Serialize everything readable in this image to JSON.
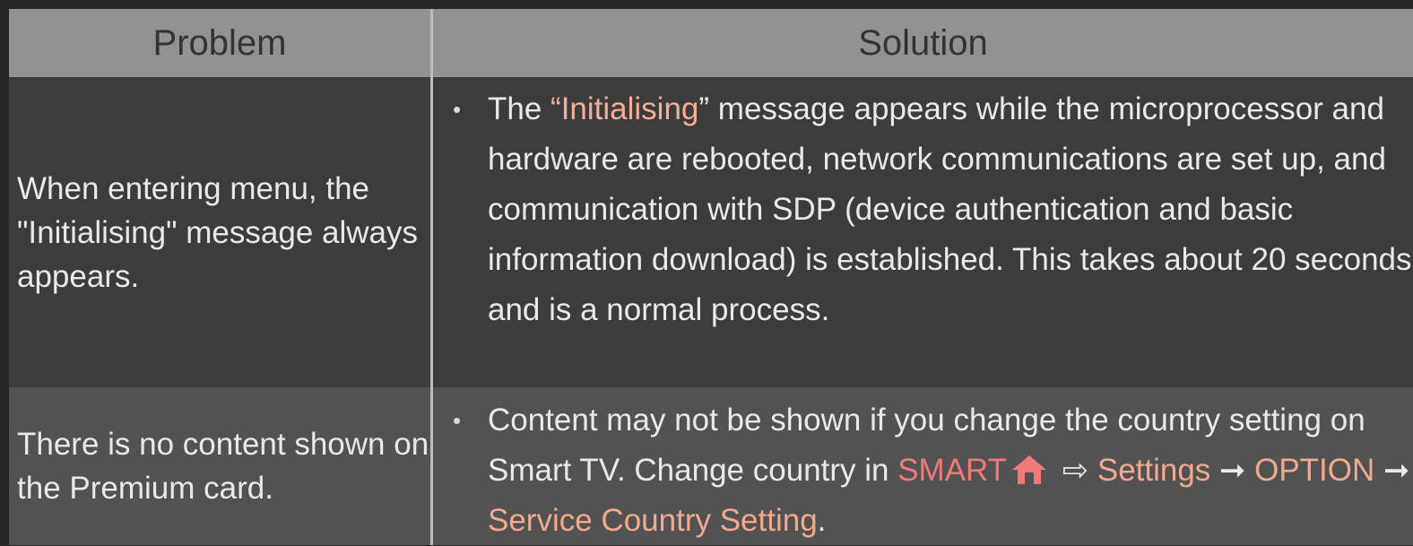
{
  "header": {
    "problem": "Problem",
    "solution": "Solution"
  },
  "rows": [
    {
      "problem": "When entering menu, the \"Initialising\" message always appears.",
      "solution": {
        "bullet": "•",
        "pre": "The ",
        "open_quote": "“",
        "keyword": "Initialising",
        "close_quote": "”",
        "post": " message appears while the microprocessor and hardware are rebooted, network communications are set up, and communication with SDP (device authentication and basic information download) is established. This takes about 20 seconds and is a normal process."
      }
    },
    {
      "problem": "There is no content shown on the Premium card.",
      "solution": {
        "bullet": "•",
        "pre": "Content may not be shown if you change the country setting on Smart TV. Change country in ",
        "smart": "SMART",
        "home_icon": "home-icon",
        "arrow1": " ⇨ ",
        "settings": "Settings",
        "arrow2": " ➞ ",
        "option": "OPTION",
        "arrow3": " ➞ ",
        "service": "Service Country Setting",
        "end": "."
      }
    }
  ],
  "colors": {
    "header_bg": "#929292",
    "row1_bg": "#3c3c3c",
    "row2_bg": "#525252",
    "highlight_orange": "#f7ad96",
    "highlight_red": "#f07a7a"
  }
}
